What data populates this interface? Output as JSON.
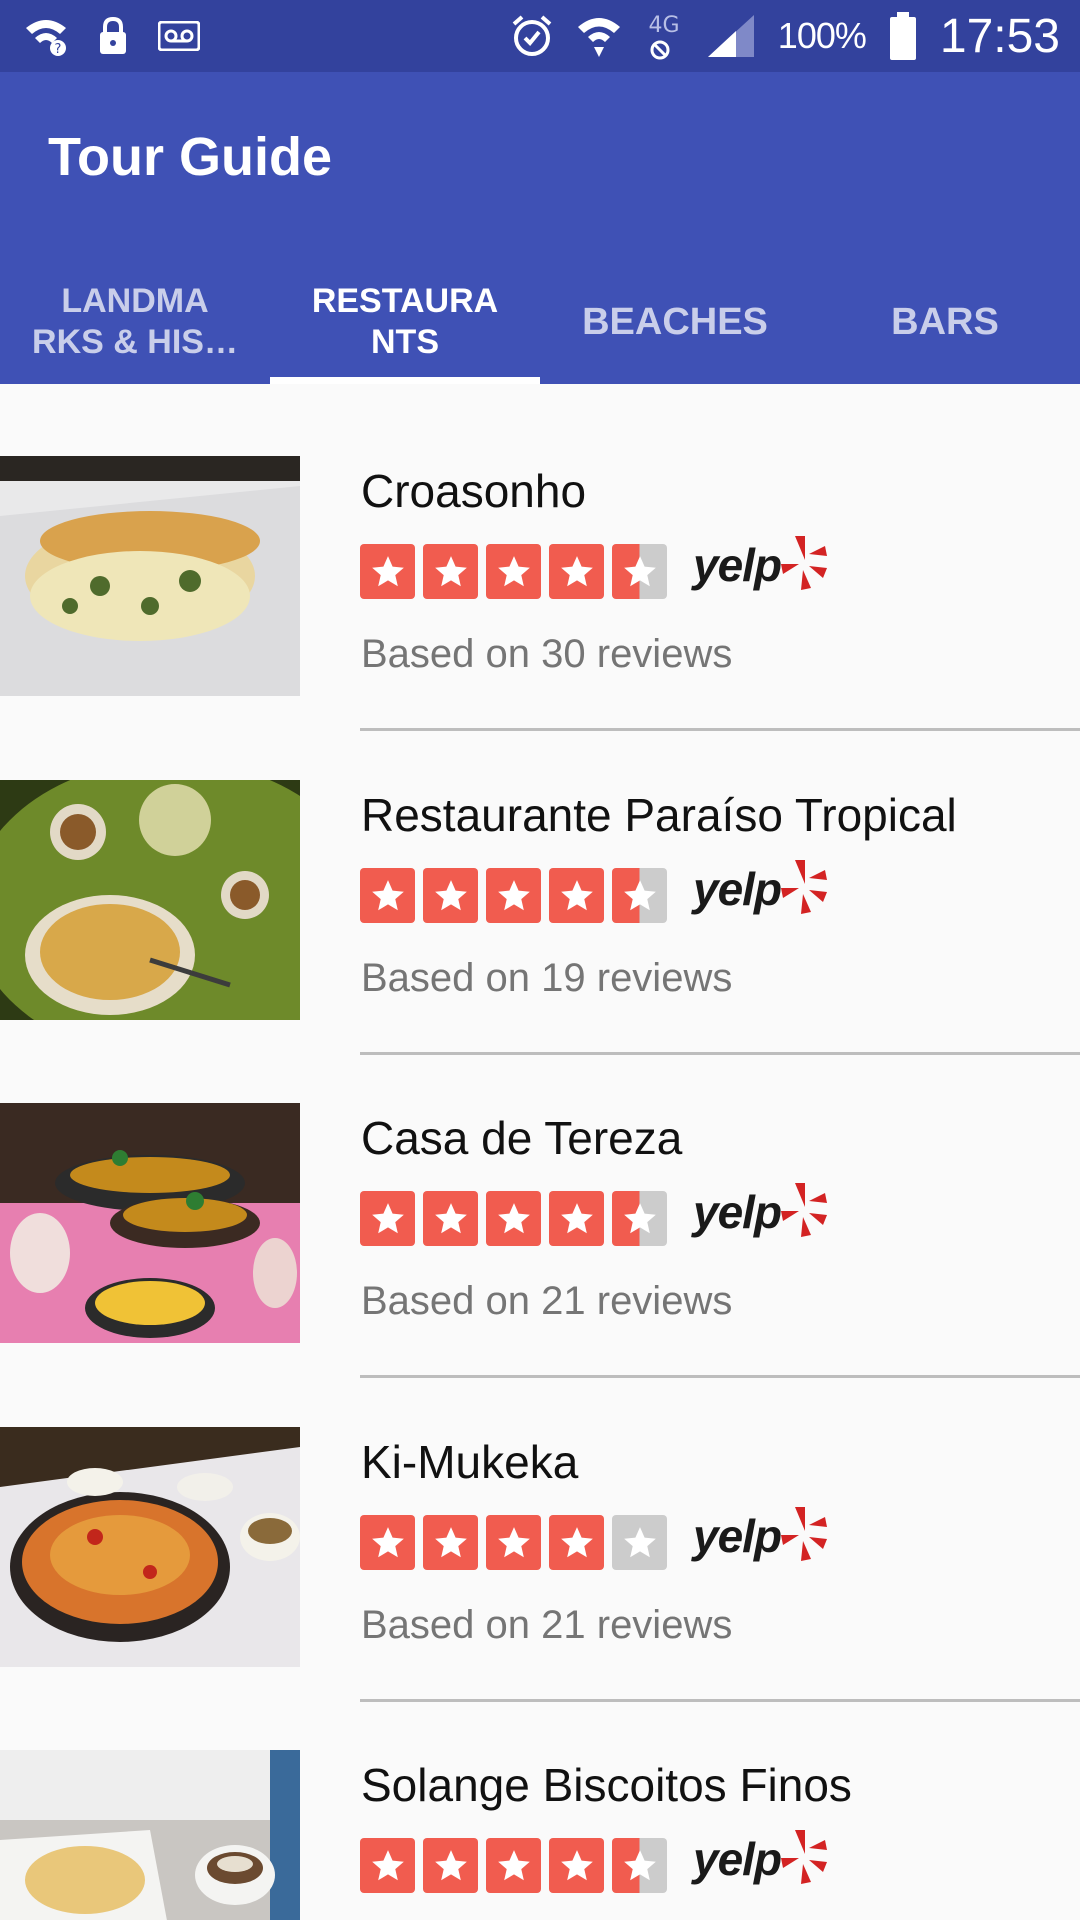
{
  "status_bar": {
    "battery_percent": "100%",
    "time": "17:53",
    "network_type": "4G",
    "icons": [
      "wifi-question-icon",
      "lock-icon",
      "voicemail-icon",
      "alarm-icon",
      "wifi-icon",
      "4g-icon",
      "signal-icon",
      "battery-icon"
    ]
  },
  "app_bar": {
    "title": "Tour Guide"
  },
  "tabs": [
    {
      "label": "LANDMA RKS & HIS…",
      "active": false
    },
    {
      "label": "RESTAURA NTS",
      "active": true
    },
    {
      "label": "BEACHES",
      "active": false
    },
    {
      "label": "BARS",
      "active": false
    }
  ],
  "restaurants": [
    {
      "name": "Croasonho",
      "rating": 4.5,
      "reviews": "Based on 30 reviews"
    },
    {
      "name": "Restaurante Paraíso Tropical",
      "rating": 4.5,
      "reviews": "Based on 19 reviews"
    },
    {
      "name": "Casa de Tereza",
      "rating": 4.5,
      "reviews": "Based on 21 reviews"
    },
    {
      "name": "Ki-Mukeka",
      "rating": 4,
      "reviews": "Based on 21 reviews"
    },
    {
      "name": "Solange Biscoitos Finos",
      "rating": 4.5,
      "reviews": ""
    }
  ],
  "yelp": {
    "label": "yelp"
  },
  "colors": {
    "status_bar": "#33429d",
    "app_bar": "#3f51b5",
    "star": "#f15c4f",
    "star_empty": "#cccccc"
  }
}
